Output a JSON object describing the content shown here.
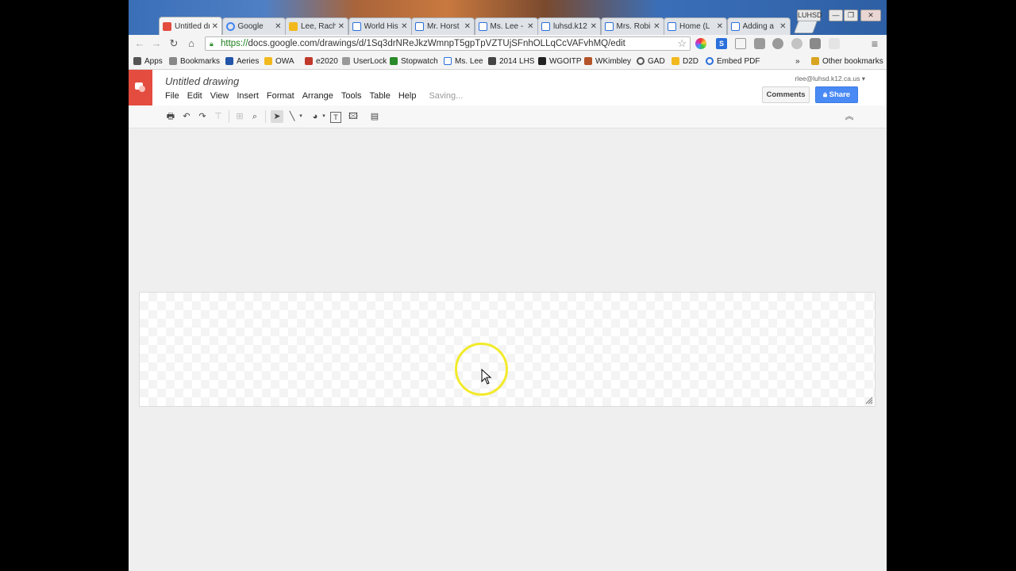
{
  "window": {
    "controls": {
      "user_badge": "LUHSD",
      "minimize": "—",
      "restore": "❐",
      "close": "✕"
    }
  },
  "tabs": [
    {
      "label": "Untitled drawing",
      "icon": "google-drawings-icon",
      "icon_color": "#e34c3e",
      "active": true
    },
    {
      "label": "Google",
      "icon": "google-g-icon",
      "icon_color": "#4285f4",
      "active": false
    },
    {
      "label": "Lee, Rachel",
      "icon": "outlook-icon",
      "icon_color": "#f2b91e",
      "active": false
    },
    {
      "label": "World History",
      "icon": "doc-page-icon",
      "icon_color": "#2a6fdc",
      "active": false
    },
    {
      "label": "Mr. Horst",
      "icon": "doc-page-icon",
      "icon_color": "#2a6fdc",
      "active": false
    },
    {
      "label": "Ms. Lee - ",
      "icon": "doc-page-icon",
      "icon_color": "#2a6fdc",
      "active": false
    },
    {
      "label": "luhsd.k12",
      "icon": "doc-page-icon",
      "icon_color": "#2a6fdc",
      "active": false
    },
    {
      "label": "Mrs. Robinson",
      "icon": "doc-page-icon",
      "icon_color": "#2a6fdc",
      "active": false
    },
    {
      "label": "Home (L",
      "icon": "doc-page-icon",
      "icon_color": "#2a6fdc",
      "active": false
    },
    {
      "label": "Adding a",
      "icon": "doc-page-icon",
      "icon_color": "#2a6fdc",
      "active": false
    }
  ],
  "tab_close_glyph": "✕",
  "address_bar": {
    "scheme": "https://",
    "rest": "docs.google.com/drawings/d/1Sq3drNReJkzWmnpT5gpTpVZTUjSFnhOLLqCcVAFvhMQ/edit"
  },
  "bookmarks": [
    {
      "label": "Apps",
      "icon": "apps-grid-icon",
      "color": "#555"
    },
    {
      "label": "Bookmarks",
      "icon": "star-icon",
      "color": "#888"
    },
    {
      "label": "Aeries",
      "icon": "aeries-a-icon",
      "color": "#2255aa"
    },
    {
      "label": "OWA",
      "icon": "outlook-icon",
      "color": "#f2b91e"
    },
    {
      "label": "e2020",
      "icon": "e2020-x-icon",
      "color": "#c0392b"
    },
    {
      "label": "UserLock",
      "icon": "doc-icon",
      "color": "#999"
    },
    {
      "label": "Stopwatch",
      "icon": "stopwatch-icon",
      "color": "#2a8a2a"
    },
    {
      "label": "Ms. Lee",
      "icon": "doc-page-icon",
      "color": "#2a6fdc"
    },
    {
      "label": "2014 LHS",
      "icon": "chart-icon",
      "color": "#444"
    },
    {
      "label": "WGOITP",
      "icon": "wgoitp-icon",
      "color": "#222"
    },
    {
      "label": "WKimbley",
      "icon": "wkimbley-icon",
      "color": "#b5542a"
    },
    {
      "label": "GAD",
      "icon": "google-g-icon",
      "color": "#555"
    },
    {
      "label": "D2D",
      "icon": "folder-icon",
      "color": "#f2b91e"
    },
    {
      "label": "Embed PDF",
      "icon": "ie-icon",
      "color": "#2a6fdc"
    }
  ],
  "bookmarks_overflow": "»",
  "other_bookmarks": "Other bookmarks",
  "docs": {
    "title": "Untitled drawing",
    "menus": [
      "File",
      "Edit",
      "View",
      "Insert",
      "Format",
      "Arrange",
      "Tools",
      "Table",
      "Help"
    ],
    "status": "Saving...",
    "account": "rlee@luhsd.k12.ca.us",
    "comments_label": "Comments",
    "share_label": "Share"
  },
  "colors": {
    "docs_brand": "#e34c3e",
    "share_blue": "#4a8af4",
    "highlight_yellow": "#f2ea2a"
  }
}
